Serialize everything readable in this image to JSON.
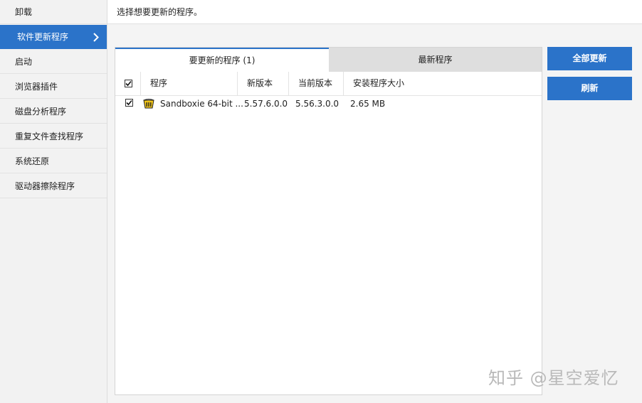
{
  "sidebar": {
    "items": [
      {
        "label": "卸载"
      },
      {
        "label": "软件更新程序"
      },
      {
        "label": "启动"
      },
      {
        "label": "浏览器插件"
      },
      {
        "label": "磁盘分析程序"
      },
      {
        "label": "重复文件查找程序"
      },
      {
        "label": "系统还原"
      },
      {
        "label": "驱动器擦除程序"
      }
    ],
    "active_index": 1
  },
  "header": {
    "instruction": "选择想要更新的程序。"
  },
  "tabs": [
    {
      "label": "要更新的程序 (1)",
      "active": true
    },
    {
      "label": "最新程序",
      "active": false
    }
  ],
  "table": {
    "columns": [
      "程序",
      "新版本",
      "当前版本",
      "安装程序大小"
    ],
    "header_checked": true,
    "rows": [
      {
        "checked": true,
        "icon": "sandboxie-icon",
        "name": "Sandboxie 64-bit ...",
        "new_version": "5.57.6.0.0",
        "current_version": "5.56.3.0.0",
        "size": "2.65 MB"
      }
    ]
  },
  "actions": {
    "update_all": "全部更新",
    "refresh": "刷新"
  },
  "watermark": "知乎 @星空爱忆",
  "colors": {
    "accent": "#2b73c9",
    "sidebar_bg": "#f2f2f2",
    "tab_inactive": "#dedede"
  }
}
